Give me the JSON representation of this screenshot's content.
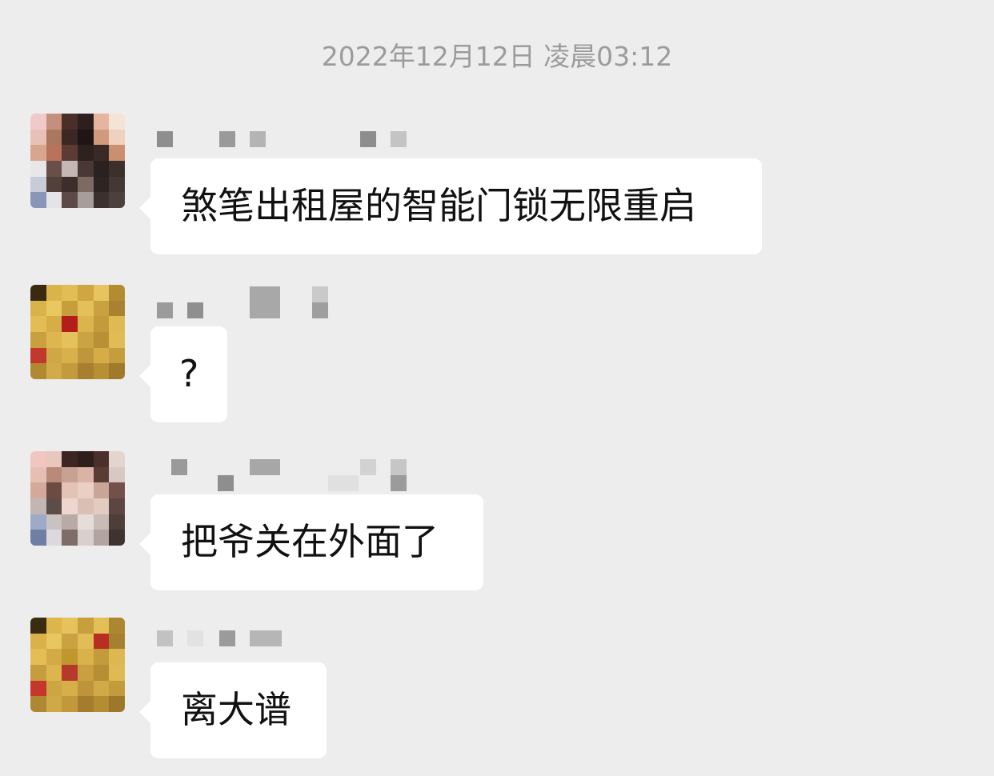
{
  "timestamp": "2022年12月12日 凌晨03:12",
  "messages": [
    {
      "sender": "",
      "text": "煞笔出租屋的智能门锁无限重启",
      "avatar_icon": "pixelated-avatar-icon"
    },
    {
      "sender": "",
      "text": "?",
      "avatar_icon": "pixelated-avatar-icon"
    },
    {
      "sender": "",
      "text": "把爷关在外面了",
      "avatar_icon": "pixelated-avatar-icon"
    },
    {
      "sender": "",
      "text": "离大谱",
      "avatar_icon": "pixelated-avatar-icon"
    }
  ],
  "colors": {
    "background": "#ededed",
    "bubble": "#ffffff",
    "timestamp_text": "#9b9b9b",
    "message_text": "#111111"
  }
}
